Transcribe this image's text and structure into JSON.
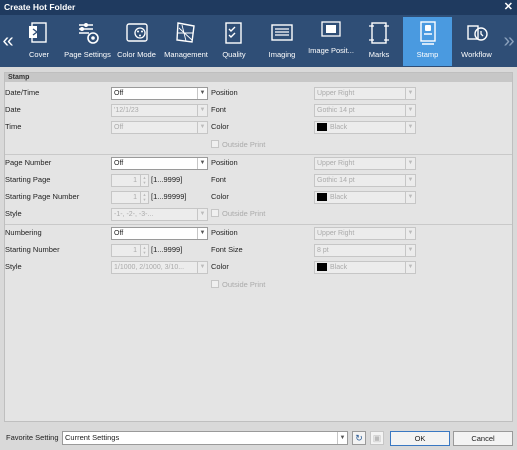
{
  "window": {
    "title": "Create Hot Folder",
    "close_glyph": "✕"
  },
  "toolbar": {
    "prev_glyph": "«",
    "next_glyph": "»",
    "items": [
      {
        "label": "Cover",
        "icon": "cover-icon"
      },
      {
        "label": "Page Settings",
        "icon": "page-settings-icon"
      },
      {
        "label": "Color Mode",
        "icon": "color-mode-icon"
      },
      {
        "label": "Management",
        "icon": "management-icon"
      },
      {
        "label": "Quality",
        "icon": "quality-icon"
      },
      {
        "label": "Imaging",
        "icon": "imaging-icon"
      },
      {
        "label": "Image Posit...",
        "icon": "image-position-icon"
      },
      {
        "label": "Marks",
        "icon": "marks-icon"
      },
      {
        "label": "Stamp",
        "icon": "stamp-icon",
        "active": true
      },
      {
        "label": "Workflow",
        "icon": "workflow-icon"
      }
    ]
  },
  "panel": {
    "header": "Stamp"
  },
  "date_section": {
    "datetime_label": "Date/Time",
    "datetime_value": "Off",
    "date_label": "Date",
    "date_value": "'12/1/23",
    "time_label": "Time",
    "time_value": "Off",
    "position_label": "Position",
    "position_value": "Upper Right",
    "font_label": "Font",
    "font_value": "Gothic 14 pt",
    "color_label": "Color",
    "color_value": "Black",
    "outside_print_label": "Outside Print"
  },
  "page_section": {
    "page_number_label": "Page Number",
    "page_number_value": "Off",
    "starting_page_label": "Starting Page",
    "starting_page_value": "1",
    "starting_page_range": "[1...9999]",
    "starting_page_number_label": "Starting Page Number",
    "starting_page_number_value": "1",
    "starting_page_number_range": "[1...99999]",
    "style_label": "Style",
    "style_value": "-1-, -2-, -3-...",
    "position_label": "Position",
    "position_value": "Upper Right",
    "font_label": "Font",
    "font_value": "Gothic 14 pt",
    "color_label": "Color",
    "color_value": "Black",
    "outside_print_label": "Outside Print"
  },
  "numbering_section": {
    "numbering_label": "Numbering",
    "numbering_value": "Off",
    "starting_number_label": "Starting Number",
    "starting_number_value": "1",
    "starting_number_range": "[1...9999]",
    "style_label": "Style",
    "style_value": "1/1000, 2/1000, 3/10...",
    "position_label": "Position",
    "position_value": "Upper Right",
    "font_size_label": "Font Size",
    "font_size_value": "8 pt",
    "color_label": "Color",
    "color_value": "Black",
    "outside_print_label": "Outside Print"
  },
  "footer": {
    "favorite_label": "Favorite Setting",
    "favorite_value": "Current Settings",
    "ok_label": "OK",
    "cancel_label": "Cancel"
  },
  "colors": {
    "titlebar": "#1f3a5f",
    "toolbar": "#2f4e76",
    "active_tab": "#4a9ae0"
  }
}
